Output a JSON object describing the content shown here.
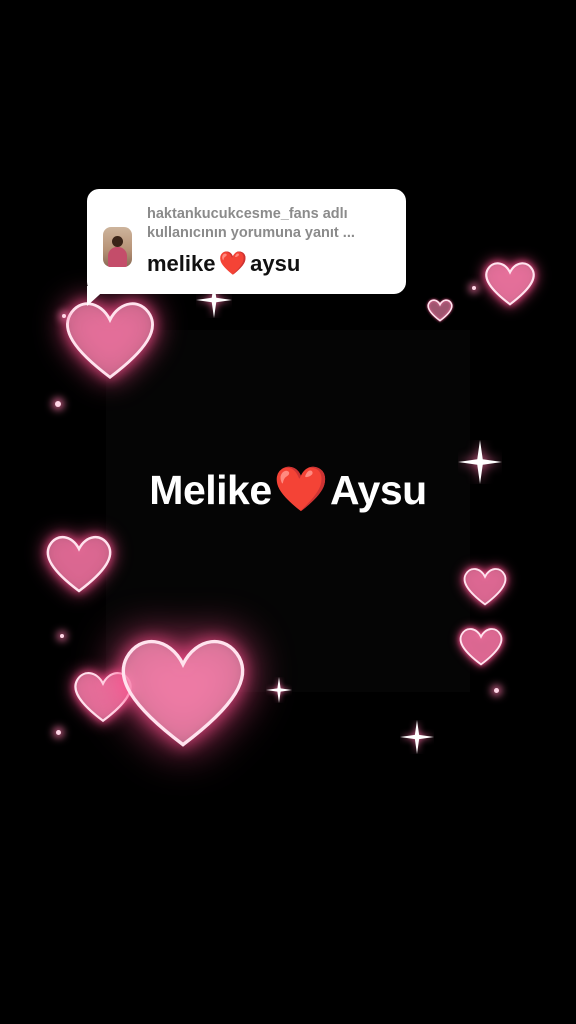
{
  "reply": {
    "line1": "haktankucukcesme_fans adlı",
    "line2": "kullanıcının yorumuna yanıt ...",
    "comment_left": "melike",
    "comment_heart": "❤️",
    "comment_right": "aysu"
  },
  "overlay": {
    "left": "Melike",
    "heart": "❤️",
    "right": "Aysu"
  },
  "colors": {
    "background": "#000000",
    "heart_glow": "#ff5a9a",
    "heart_fill": "#f4a6c3",
    "emoji_heart": "#e0161f"
  },
  "icons": {
    "decorative": [
      "heart-icon",
      "sparkle-icon"
    ]
  }
}
